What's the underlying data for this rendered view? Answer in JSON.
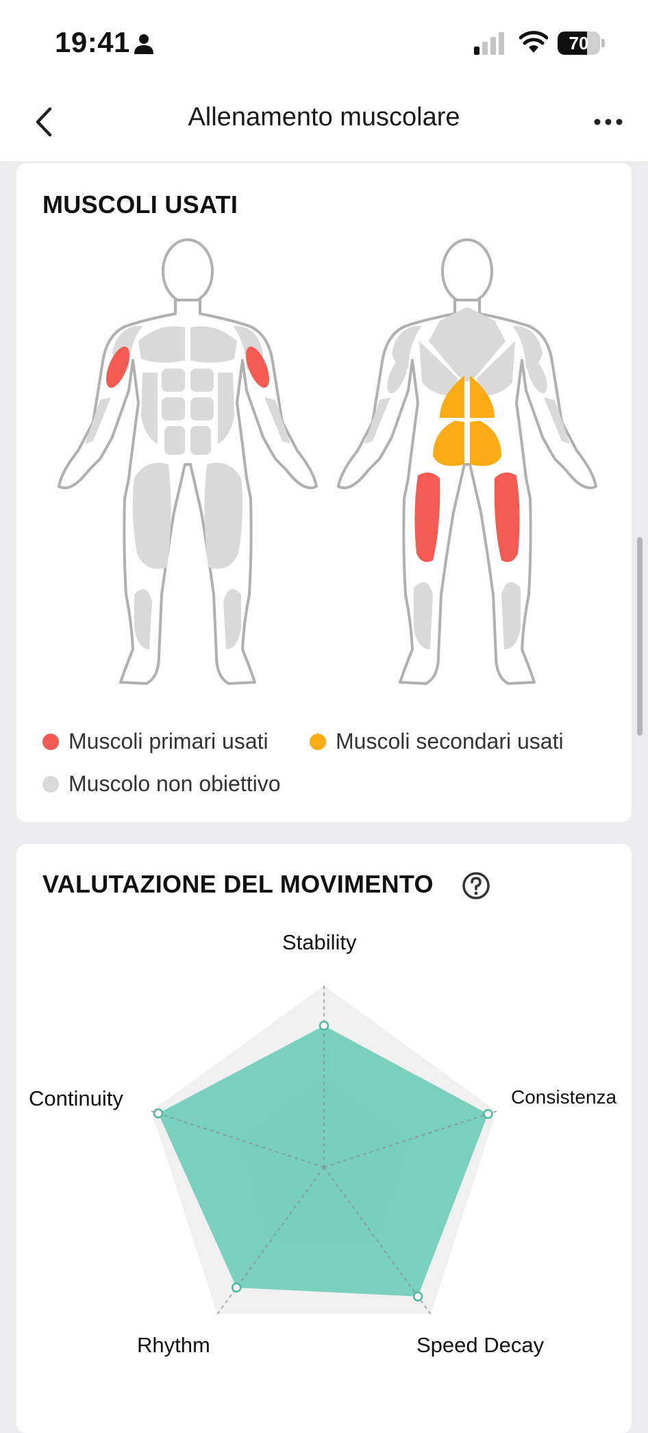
{
  "status_bar": {
    "time": "19:41",
    "battery_percent": "70",
    "battery_level": 0.7,
    "signal_bars_active": 1,
    "icons": [
      "person-icon",
      "signal-icon",
      "wifi-icon",
      "battery-icon"
    ]
  },
  "nav": {
    "title": "Allenamento muscolare",
    "back_icon": "chevron-left-icon",
    "more_icon": "ellipsis-icon"
  },
  "muscles_card": {
    "title": "MUSCOLI USATI",
    "legend": {
      "primary": "Muscoli primari usati",
      "secondary": "Muscoli secondari usati",
      "non_target": "Muscolo non obiettivo"
    },
    "colors": {
      "primary": "#f25a52",
      "secondary": "#fbab14",
      "non_target": "#d9d9d9",
      "outline": "#b0b0b0"
    },
    "front_primary": [
      "biceps"
    ],
    "back_primary": [
      "hamstrings"
    ],
    "back_secondary": [
      "lower-back",
      "glutes"
    ]
  },
  "evaluation_card": {
    "title": "VALUTAZIONE DEL MOVIMENTO",
    "help_icon": "question-circle-icon",
    "radar": {
      "axes": [
        "Stability",
        "Consistenza",
        "Speed Decay",
        "Rhythm",
        "Continuity"
      ],
      "values": [
        0.78,
        0.95,
        0.88,
        0.82,
        0.96
      ],
      "fill_color": "#6fcdb7",
      "background_color": "#f0f0f0"
    }
  }
}
